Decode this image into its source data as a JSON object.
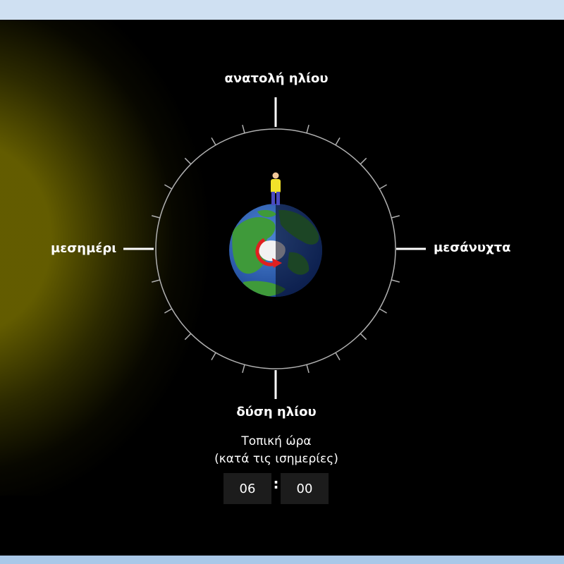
{
  "labels": {
    "sunrise": "ανατολή ηλίου",
    "sunset": "δύση ηλίου",
    "noon": "μεσημέρι",
    "midnight": "μεσάνυχτα"
  },
  "clock": {
    "caption_line1": "Τοπική ώρα",
    "caption_line2": "(κατά τις ισημερίες)",
    "hours": "06",
    "minutes": "00",
    "separator": ":"
  },
  "colors": {
    "sun_glow": "#746c00",
    "ocean": "#2a5cb0",
    "land": "#3f9a3a",
    "dial_ring": "#b0b0b0",
    "person_shirt": "#f2e22a",
    "person_pants": "#4a4ac0"
  },
  "icons": {
    "earth": "earth-globe-icon",
    "rotation": "rotation-arrow-icon",
    "person": "person-figure-icon"
  }
}
